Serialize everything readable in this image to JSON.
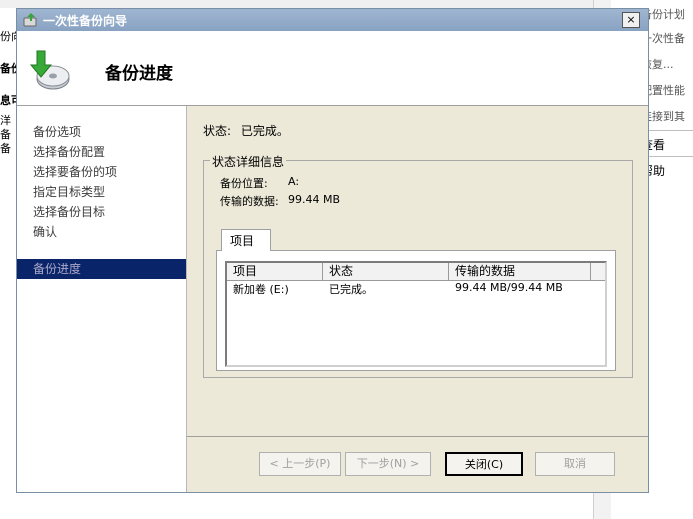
{
  "window": {
    "title": "一次性备份向导",
    "close_glyph": "×"
  },
  "header": {
    "title": "备份进度",
    "icon": "backup-disk-icon"
  },
  "nav": {
    "items": [
      {
        "label": "备份选项"
      },
      {
        "label": "选择备份配置"
      },
      {
        "label": "选择要备份的项"
      },
      {
        "label": "指定目标类型"
      },
      {
        "label": "选择备份目标"
      },
      {
        "label": "确认"
      },
      {
        "label": "备份进度"
      }
    ],
    "active_index": 6
  },
  "status": {
    "label": "状态:",
    "value": "已完成。"
  },
  "details": {
    "group_title": "状态详细信息",
    "location_label": "备份位置:",
    "location_value": "A:",
    "transferred_label": "传输的数据:",
    "transferred_value": "99.44 MB",
    "tab_label": "项目"
  },
  "table": {
    "columns": [
      "项目",
      "状态",
      "传输的数据"
    ],
    "rows": [
      [
        "新加卷 (E:)",
        "已完成。",
        "99.44 MB/99.44 MB"
      ]
    ]
  },
  "buttons": {
    "back": "< 上一步(P)",
    "next": "下一步(N) >",
    "close": "关闭(C)",
    "cancel": "取消"
  },
  "background": {
    "left": [
      "份向",
      "备份",
      "息可",
      "洋",
      "备",
      "备"
    ],
    "right": [
      "备份计划",
      "一次性备",
      "恢复...",
      "配置性能",
      "连接到其",
      "查看",
      "帮助"
    ]
  },
  "colors": {
    "nav_active_bg": "#0a246a",
    "title_bar": "#9fb6d1",
    "dialog_bg": "#ece9d8"
  }
}
